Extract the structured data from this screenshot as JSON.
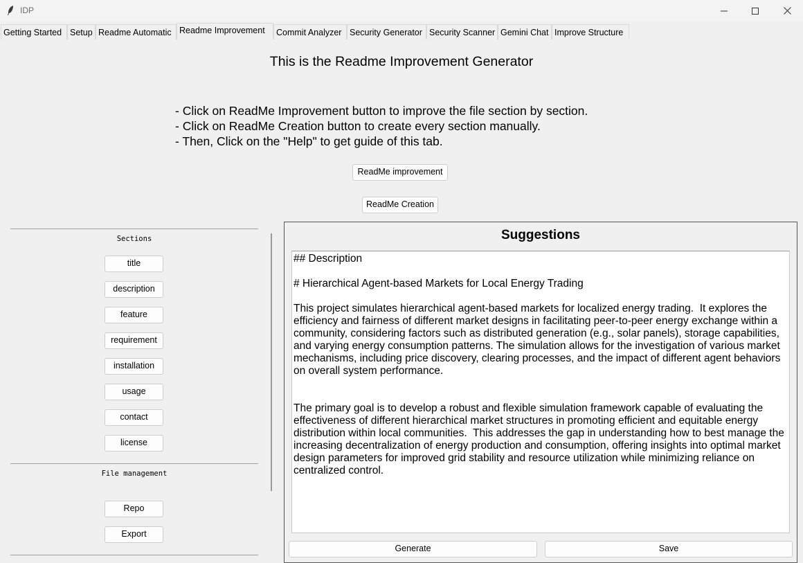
{
  "window": {
    "title": "IDP"
  },
  "tabs": [
    {
      "label": "Getting Started"
    },
    {
      "label": "Setup"
    },
    {
      "label": "Readme Automatic"
    },
    {
      "label": "Readme Improvement"
    },
    {
      "label": "Commit Analyzer"
    },
    {
      "label": "Security Generator"
    },
    {
      "label": "Security Scanner"
    },
    {
      "label": "Gemini Chat"
    },
    {
      "label": "Improve Structure"
    }
  ],
  "main": {
    "heading": "This is the Readme Improvement Generator",
    "instructions": [
      "- Click on ReadMe Improvement button to improve the file section by section.",
      "- Click on ReadMe Creation button to create every section manually.",
      "- Then, Click on the \"Help\" to get guide of this tab."
    ],
    "improvement_button": "ReadMe improvement",
    "creation_button": "ReadMe Creation"
  },
  "sidebar": {
    "sections_label": "Sections",
    "sections": [
      "title",
      "description",
      "feature",
      "requirement",
      "installation",
      "usage",
      "contact",
      "license"
    ],
    "file_management_label": "File management",
    "repo_button": "Repo",
    "export_button": "Export"
  },
  "suggestions": {
    "title": "Suggestions",
    "text": "## Description\n\n# Hierarchical Agent-based Markets for Local Energy Trading\n\nThis project simulates hierarchical agent-based markets for localized energy trading.  It explores the efficiency and fairness of different market designs in facilitating peer-to-peer energy exchange within a community, considering factors such as distributed generation (e.g., solar panels), storage capabilities, and varying energy consumption patterns. The simulation allows for the investigation of various market mechanisms, including price discovery, clearing processes, and the impact of different agent behaviors on overall system performance.\n\n\nThe primary goal is to develop a robust and flexible simulation framework capable of evaluating the effectiveness of different hierarchical market structures in promoting efficient and equitable energy distribution within local communities.  This addresses the gap in understanding how to best manage the increasing decentralization of energy production and consumption, offering insights into optimal market design parameters for improved grid stability and resource utilization while minimizing reliance on centralized control.",
    "generate_button": "Generate",
    "save_button": "Save"
  }
}
